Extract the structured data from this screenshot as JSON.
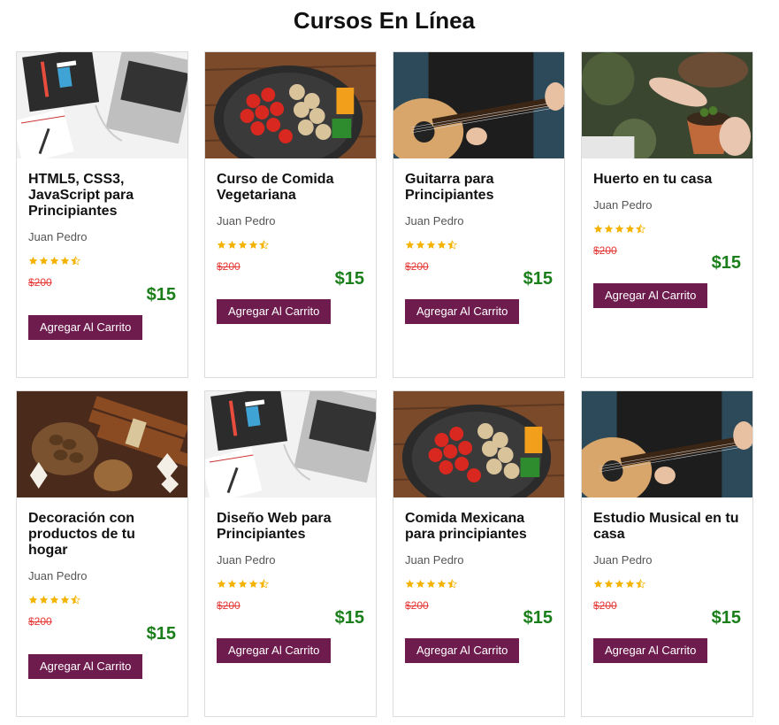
{
  "page": {
    "title": "Cursos En Línea"
  },
  "colors": {
    "button": "#6e1b4e",
    "price": "#1a7f1a",
    "old_price": "#e53935",
    "star": "#f5b301"
  },
  "courses": [
    {
      "title": "HTML5, CSS3, JavaScript para Principiantes",
      "author": "Juan Pedro",
      "rating": 4.5,
      "old_price": "$200",
      "price": "$15",
      "button": "Agregar Al Carrito",
      "image": "laptop-workspace"
    },
    {
      "title": "Curso de Comida Vegetariana",
      "author": "Juan Pedro",
      "rating": 4.5,
      "old_price": "$200",
      "price": "$15",
      "button": "Agregar Al Carrito",
      "image": "vegetable-pan"
    },
    {
      "title": "Guitarra para Principiantes",
      "author": "Juan Pedro",
      "rating": 4.5,
      "old_price": "$200",
      "price": "$15",
      "button": "Agregar Al Carrito",
      "image": "guitar-player"
    },
    {
      "title": "Huerto en tu casa",
      "author": "Juan Pedro",
      "rating": 4.5,
      "old_price": "$200",
      "price": "$15",
      "button": "Agregar Al Carrito",
      "image": "plant-pot"
    },
    {
      "title": "Decoración con productos de tu hogar",
      "author": "Juan Pedro",
      "rating": 4.5,
      "old_price": "$200",
      "price": "$15",
      "button": "Agregar Al Carrito",
      "image": "cinnamon-decor"
    },
    {
      "title": "Diseño Web para Principiantes",
      "author": "Juan Pedro",
      "rating": 4.5,
      "old_price": "$200",
      "price": "$15",
      "button": "Agregar Al Carrito",
      "image": "laptop-workspace"
    },
    {
      "title": "Comida Mexicana para principiantes",
      "author": "Juan Pedro",
      "rating": 4.5,
      "old_price": "$200",
      "price": "$15",
      "button": "Agregar Al Carrito",
      "image": "vegetable-pan"
    },
    {
      "title": "Estudio Musical en tu casa",
      "author": "Juan Pedro",
      "rating": 4.5,
      "old_price": "$200",
      "price": "$15",
      "button": "Agregar Al Carrito",
      "image": "guitar-player"
    }
  ]
}
